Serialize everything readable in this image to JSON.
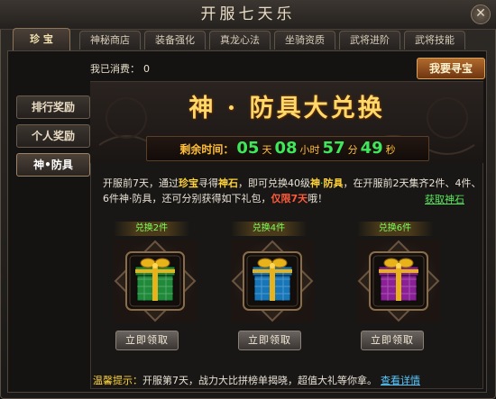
{
  "window": {
    "title": "开服七天乐",
    "close_icon": "close-icon"
  },
  "tabs": [
    "珍 宝",
    "神秘商店",
    "装备强化",
    "真龙心法",
    "坐骑资质",
    "武将进阶",
    "武将技能"
  ],
  "spent": {
    "label": "我已消费：",
    "value": "0"
  },
  "seek_button": "我要寻宝",
  "sidebar": [
    "排行奖励",
    "个人奖励",
    "神•防具"
  ],
  "banner": {
    "title": "神 · 防具大兑换"
  },
  "timer": {
    "label": "剩余时间：",
    "days": "05",
    "days_unit": "天",
    "hours": "08",
    "hours_unit": "小时",
    "minutes": "57",
    "minutes_unit": "分",
    "seconds": "49",
    "seconds_unit": "秒"
  },
  "desc": {
    "p1": "开服前7天，通过",
    "treasure": "珍宝",
    "p2": "寻得",
    "stone": "神石",
    "p3": "，即可兑换40级",
    "shen": "神",
    "dot": "·",
    "armor": "防具",
    "p4": "，在开服前2天集齐2件、4件、6件神·防具，还可分别获得如下礼包，",
    "limit": "仅限7天",
    "p5": "哦！"
  },
  "get_stone_link": "获取神石",
  "packs": [
    {
      "label": "兑换2件",
      "color": "#1f8a3a",
      "ribbon": "#e8b21a",
      "button": "立即领取"
    },
    {
      "label": "兑换4件",
      "color": "#1776b8",
      "ribbon": "#e8b21a",
      "button": "立即领取"
    },
    {
      "label": "兑换6件",
      "color": "#8a1f96",
      "ribbon": "#e8b21a",
      "button": "立即领取"
    }
  ],
  "tips": {
    "label": "温馨提示：",
    "text": "开服第7天，战力大比拼榜单揭晓，超值大礼等你拿。",
    "link": "查看详情"
  },
  "colors": {
    "accent_gold": "#ffd86a",
    "timer_green": "#3ee85a",
    "link_green": "#58e85c",
    "link_blue": "#58c8ff"
  }
}
